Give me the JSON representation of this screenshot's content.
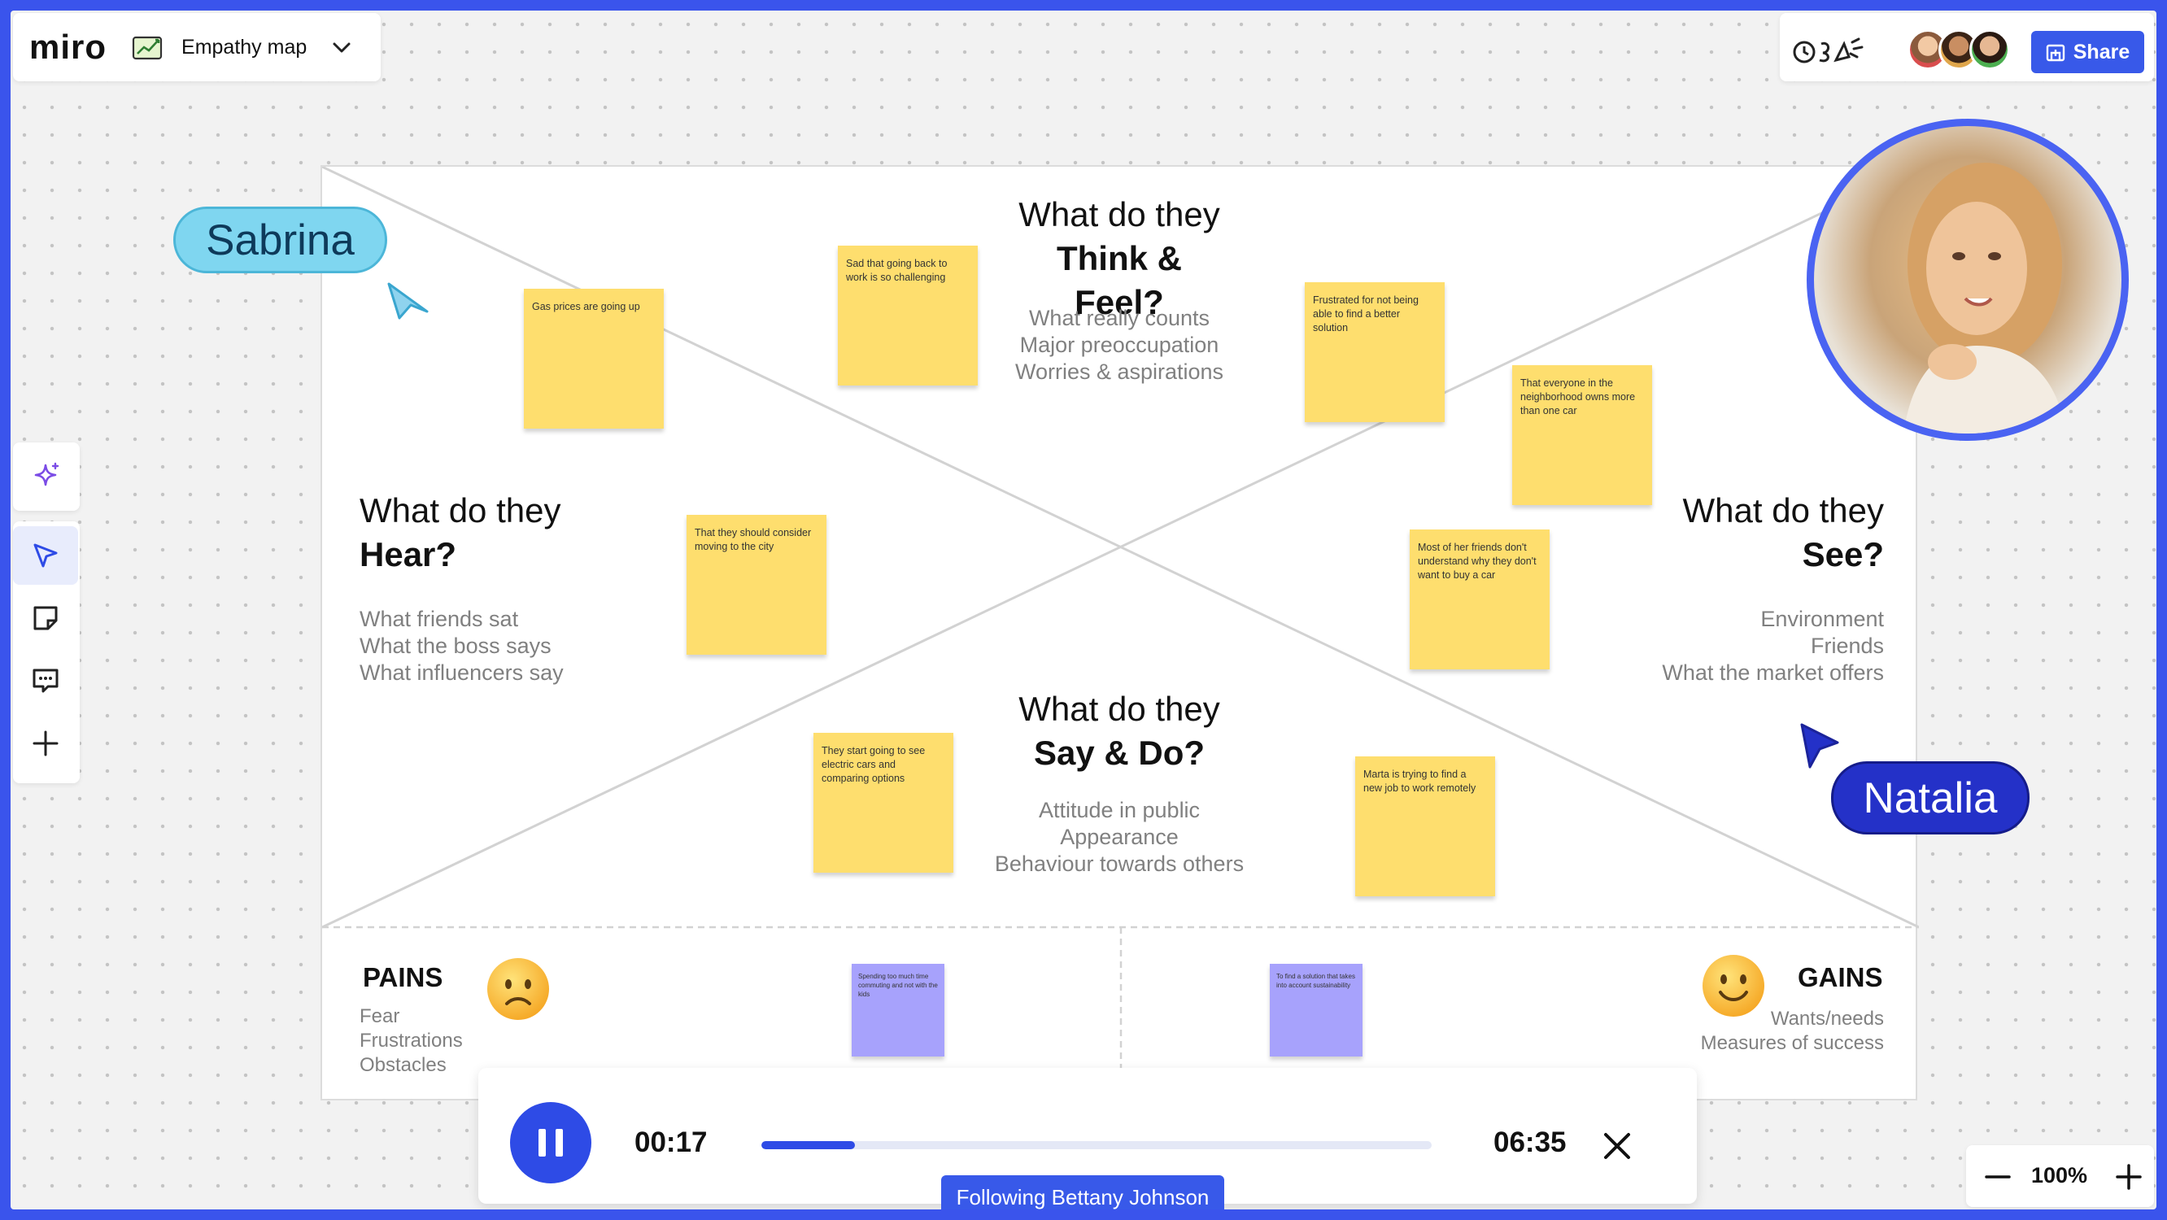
{
  "app": {
    "logo": "miro",
    "board_name": "Empathy map"
  },
  "share": {
    "label": "Share"
  },
  "quadrants": {
    "think_feel": {
      "line1": "What do they",
      "line2": "Think & Feel?",
      "subs": [
        "What really counts",
        "Major preoccupation",
        "Worries & aspirations"
      ]
    },
    "hear": {
      "line1": "What do they",
      "line2": "Hear?",
      "subs": [
        "What friends sat",
        "What the boss says",
        "What influencers say"
      ]
    },
    "see": {
      "line1": "What do they",
      "line2": "See?",
      "subs": [
        "Environment",
        "Friends",
        "What the market offers"
      ]
    },
    "say_do": {
      "line1": "What do they",
      "line2": "Say & Do?",
      "subs": [
        "Attitude in public",
        "Appearance",
        "Behaviour towards others"
      ]
    }
  },
  "pains": {
    "title": "PAINS",
    "items": [
      "Fear",
      "Frustrations",
      "Obstacles"
    ]
  },
  "gains": {
    "title": "GAINS",
    "items": [
      "Wants/needs",
      "Measures of success"
    ]
  },
  "stickies": [
    "Gas prices are going up",
    "Sad that going back to work is so challenging",
    "Frustrated for not being able to find a better solution",
    "That everyone in the neighborhood owns more than one car",
    "That they should consider moving to the city",
    "Most of her friends don't understand why they don't want to buy a car",
    "They start going to see electric cars and comparing options",
    "Marta is trying to find a new job to work remotely",
    "Spending too much time commuting and not with the kids",
    "To find a solution that takes into account sustainability"
  ],
  "cursors": {
    "sabrina": {
      "name": "Sabrina",
      "color": "#7fd6f0",
      "text_color": "#0e3a5a"
    },
    "natalia": {
      "name": "Natalia",
      "color": "#2431c8",
      "text_color": "#ffffff"
    }
  },
  "player": {
    "elapsed": "00:17",
    "total": "06:35",
    "progress": 0.14
  },
  "following": "Following Bettany Johnson",
  "zoom": "100%"
}
